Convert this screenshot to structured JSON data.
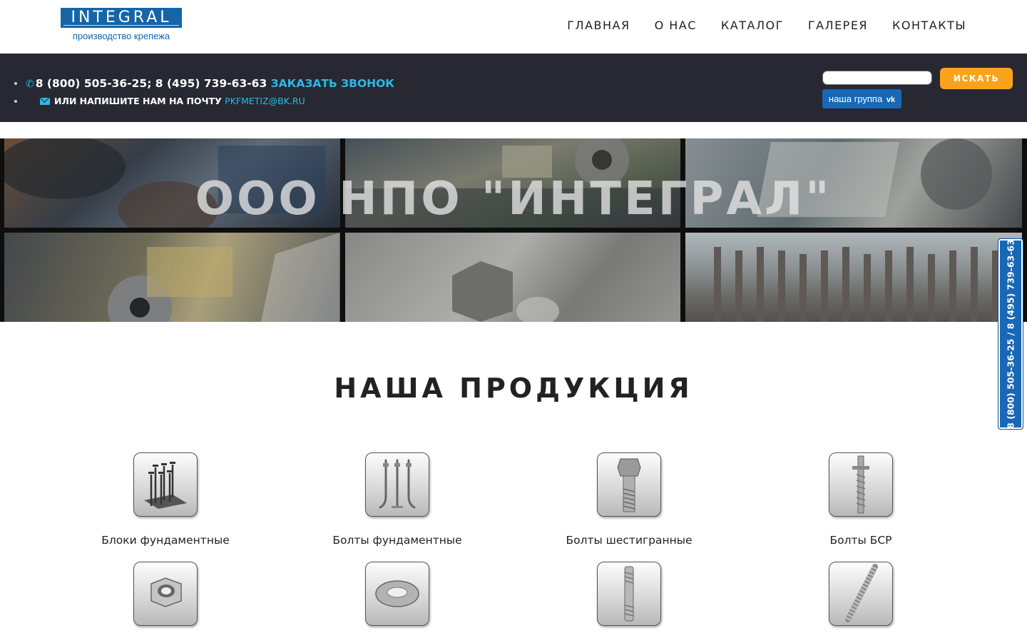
{
  "logo": {
    "text": "INTEGRAL",
    "subtitle": "производство крепежа"
  },
  "nav": {
    "items": [
      "ГЛАВНАЯ",
      "О НАС",
      "КАТАЛОГ",
      "ГАЛЕРЕЯ",
      "КОНТАКТЫ"
    ]
  },
  "topbar": {
    "phones": "8 (800) 505-36-25; 8 (495) 739-63-63",
    "callback": "ЗАКАЗАТЬ ЗВОНОК",
    "mail_label": "ИЛИ НАПИШИТЕ НАМ НА ПОЧТУ",
    "email": "PKFMETIZ@BK.RU",
    "search_value": "",
    "search_button": "ИСКАТЬ",
    "vk_label": "наша группа",
    "vk_icon": "vk"
  },
  "hero": {
    "title": "ООО НПО \"ИНТЕГРАЛ\""
  },
  "side_phone": "8 (800) 505-36-25 / 8 (495) 739-63-63",
  "products": {
    "title": "НАША ПРОДУКЦИЯ",
    "items": [
      {
        "label": "Блоки фундаментные",
        "icon": "foundation-block-icon"
      },
      {
        "label": "Болты фундаментные",
        "icon": "foundation-bolt-icon"
      },
      {
        "label": "Болты шестигранные",
        "icon": "hex-bolt-icon"
      },
      {
        "label": "Болты БСР",
        "icon": "bsr-bolt-icon"
      },
      {
        "label": "",
        "icon": "hex-nut-icon"
      },
      {
        "label": "",
        "icon": "washer-icon"
      },
      {
        "label": "",
        "icon": "stud-icon"
      },
      {
        "label": "",
        "icon": "threaded-rod-icon"
      }
    ]
  },
  "colors": {
    "accent_blue": "#2db8e8",
    "brand_blue": "#1868b5",
    "orange": "#f9a31a",
    "dark_bar": "#272831"
  }
}
